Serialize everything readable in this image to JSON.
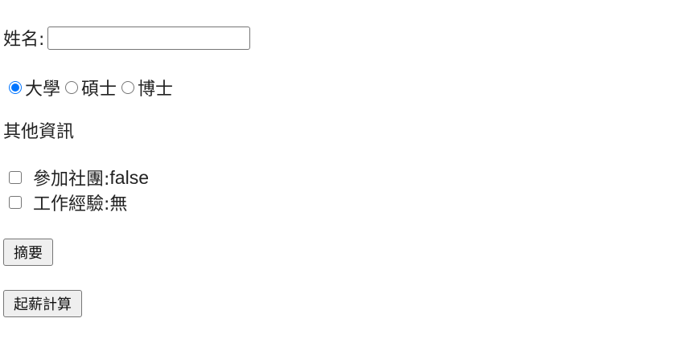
{
  "form": {
    "name_label": "姓名:",
    "name_value": "",
    "name_placeholder": "",
    "degree": {
      "options": [
        {
          "label": "大學",
          "checked": true
        },
        {
          "label": "碩士",
          "checked": false
        },
        {
          "label": "博士",
          "checked": false
        }
      ]
    },
    "other_info_heading": "其他資訊",
    "club": {
      "label": "參加社團:",
      "value": "false",
      "checked": false
    },
    "experience": {
      "label": "工作經驗:",
      "value": "無",
      "checked": false
    },
    "summary_button": "摘要",
    "salary_button": "起薪計算",
    "accent_color": "#0075ff"
  }
}
